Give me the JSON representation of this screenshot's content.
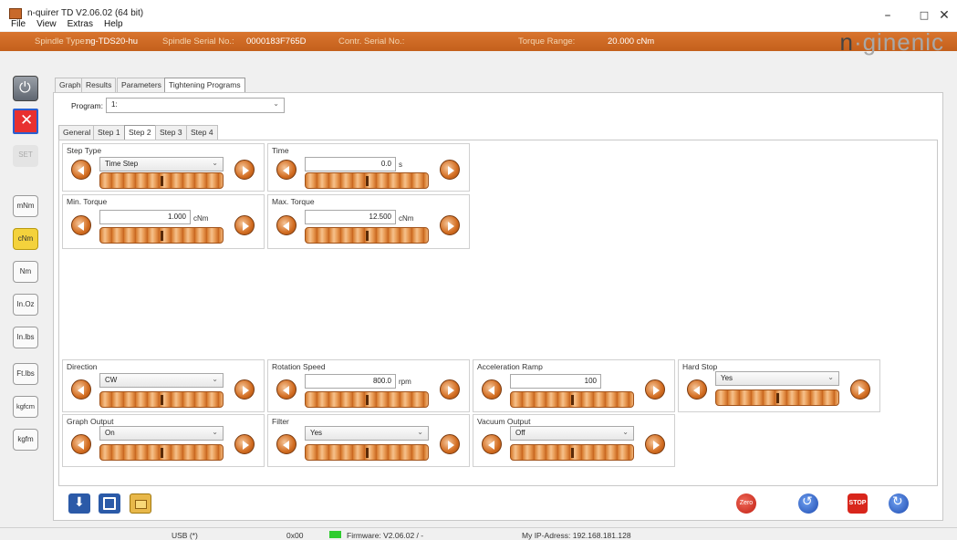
{
  "window": {
    "title": "n-quirer TD V2.06.02 (64 bit)",
    "min": "–",
    "max": "□",
    "close": "✕"
  },
  "menu": [
    "File",
    "View",
    "Extras",
    "Help"
  ],
  "info": {
    "spindle_type_label": "Spindle Type:",
    "spindle_type": "ng-TDS20-hu",
    "spindle_serial_label": "Spindle Serial No.:",
    "spindle_serial": "0000183F765D",
    "contr_serial_label": "Contr. Serial No.:",
    "torque_range_label": "Torque Range:",
    "torque_range": "20.000 cNm",
    "brand_a": "n",
    "brand_b": "·ginenic"
  },
  "left_buttons": {
    "set": "SET",
    "units": [
      "mNm",
      "cNm",
      "Nm",
      "In.Oz",
      "In.lbs",
      "Ft.lbs",
      "kgfcm",
      "kgfm"
    ],
    "selected": "cNm"
  },
  "main_tabs": [
    "Graph",
    "Results",
    "Parameters",
    "Tightening Programs"
  ],
  "program": {
    "label": "Program:",
    "value": "1:"
  },
  "step_tabs": [
    "General",
    "Step 1",
    "Step 2",
    "Step 3",
    "Step 4"
  ],
  "groups": {
    "step_type": {
      "label": "Step Type",
      "value": "Time Step"
    },
    "time": {
      "label": "Time",
      "value": "0.0",
      "unit": "s"
    },
    "min_torque": {
      "label": "Min. Torque",
      "value": "1.000",
      "unit": "cNm"
    },
    "max_torque": {
      "label": "Max. Torque",
      "value": "12.500",
      "unit": "cNm"
    },
    "direction": {
      "label": "Direction",
      "value": "CW"
    },
    "rotation_speed": {
      "label": "Rotation Speed",
      "value": "800.0",
      "unit": "rpm"
    },
    "acceleration_ramp": {
      "label": "Acceleration Ramp",
      "value": "100"
    },
    "hard_stop": {
      "label": "Hard Stop",
      "value": "Yes"
    },
    "graph_output": {
      "label": "Graph Output",
      "value": "On"
    },
    "filter": {
      "label": "Filter",
      "value": "Yes"
    },
    "vacuum_output": {
      "label": "Vacuum Output",
      "value": "Off"
    }
  },
  "toolbar": {
    "zero": "Zero",
    "stop": "STOP"
  },
  "status": {
    "usb": "USB (*)",
    "code": "0x00",
    "firmware": "Firmware: V2.06.02 / -",
    "ip": "My IP-Adress: 192.168.181.128"
  },
  "colors": {
    "accent": "#d26c20",
    "selected_unit": "#f4d23c",
    "firmware_ok": "#2ecc2e",
    "stop": "#d8261c"
  }
}
